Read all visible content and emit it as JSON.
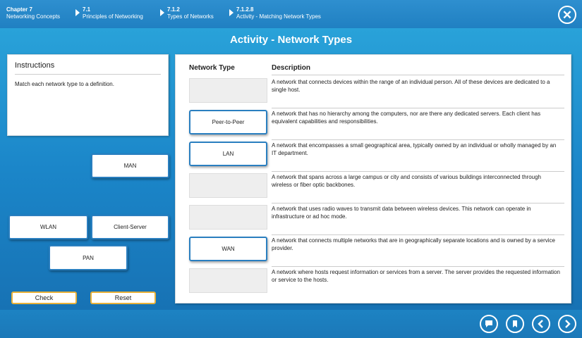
{
  "breadcrumb": [
    {
      "num": "Chapter 7",
      "text": "Networking Concepts"
    },
    {
      "num": "7.1",
      "text": "Principles of Networking"
    },
    {
      "num": "7.1.2",
      "text": "Types of Networks"
    },
    {
      "num": "7.1.2.8",
      "text": "Activity - Matching Network Types"
    }
  ],
  "title": "Activity - Network Types",
  "instructions": {
    "heading": "Instructions",
    "text": "Match each network type to a definition."
  },
  "table": {
    "col_type": "Network Type",
    "col_desc": "Description",
    "rows": [
      {
        "answer": "",
        "desc": "A network that connects devices within the range of an individual person. All of these devices are dedicated to a single host."
      },
      {
        "answer": "Peer-to-Peer",
        "desc": " A network that has no hierarchy among the computers, nor are there any dedicated servers. Each client has equivalent capabilities and responsibilities."
      },
      {
        "answer": "LAN",
        "desc": "A network that encompasses a small geographical area, typically owned by an individual or wholly managed by an IT department."
      },
      {
        "answer": "",
        "desc": "A network that spans across a large campus or city and consists of various buildings interconnected through wireless or fiber optic backbones."
      },
      {
        "answer": "",
        "desc": "A network that uses radio waves to transmit data between wireless devices. This network can operate in infrastructure or ad hoc mode."
      },
      {
        "answer": "WAN",
        "desc": "A network that connects multiple networks that are in geographically separate locations and is owned by a service provider."
      },
      {
        "answer": "",
        "desc": "A network where hosts request information or services from a server. The server provides the requested information or service to the hosts."
      }
    ]
  },
  "choices": {
    "man": "MAN",
    "wlan": "WLAN",
    "client_server": "Client-Server",
    "pan": "PAN"
  },
  "buttons": {
    "check": "Check",
    "reset": "Reset"
  },
  "icons": {
    "close": "close-icon",
    "chat": "chat-icon",
    "bookmark": "bookmark-icon",
    "prev": "chevron-left-icon",
    "next": "chevron-right-icon"
  }
}
